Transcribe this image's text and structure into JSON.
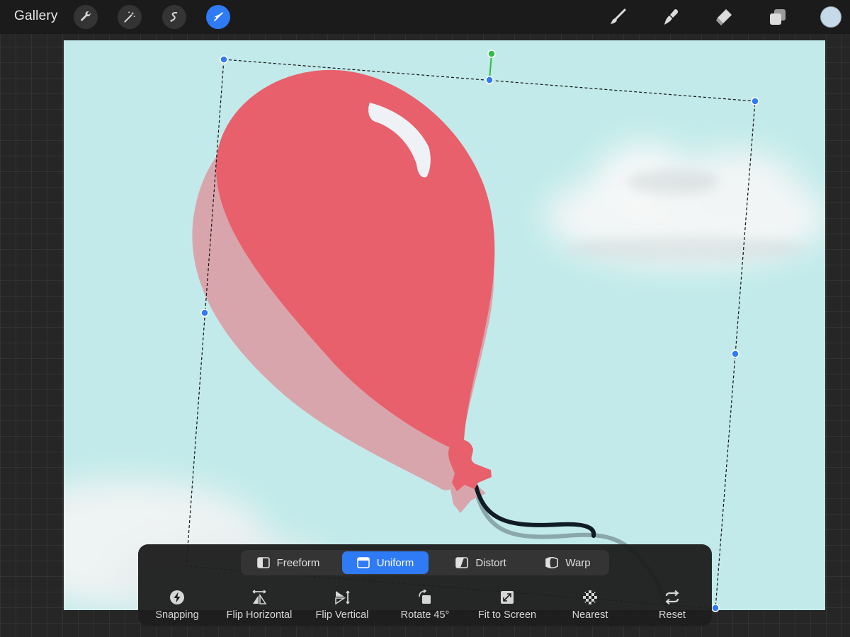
{
  "topbar": {
    "gallery_label": "Gallery",
    "left_tools": [
      "wrench-icon",
      "magic-wand-icon",
      "selection-icon",
      "transform-arrow-icon"
    ],
    "active_tool": "transform-arrow-icon",
    "right_tools": [
      "brush-icon",
      "smudge-icon",
      "eraser-icon",
      "layers-icon"
    ],
    "current_color": "#c5d9e8"
  },
  "colors": {
    "accent": "#2f7af5",
    "canvas_sky": "#c2eaea",
    "balloon": "#e8606b",
    "balloon_shadow": "#d9a5ad",
    "rotation_handle": "#2ebd45"
  },
  "transform_panel": {
    "modes": [
      {
        "label": "Freeform",
        "icon": "freeform-icon"
      },
      {
        "label": "Uniform",
        "icon": "uniform-icon"
      },
      {
        "label": "Distort",
        "icon": "distort-icon"
      },
      {
        "label": "Warp",
        "icon": "warp-icon"
      }
    ],
    "active_mode": "Uniform",
    "actions": [
      {
        "label": "Snapping",
        "icon": "snapping-icon"
      },
      {
        "label": "Flip Horizontal",
        "icon": "flip-horizontal-icon"
      },
      {
        "label": "Flip Vertical",
        "icon": "flip-vertical-icon"
      },
      {
        "label": "Rotate 45°",
        "icon": "rotate-45-icon"
      },
      {
        "label": "Fit to Screen",
        "icon": "fit-to-screen-icon"
      },
      {
        "label": "Nearest",
        "icon": "nearest-icon"
      },
      {
        "label": "Reset",
        "icon": "reset-icon"
      }
    ]
  }
}
